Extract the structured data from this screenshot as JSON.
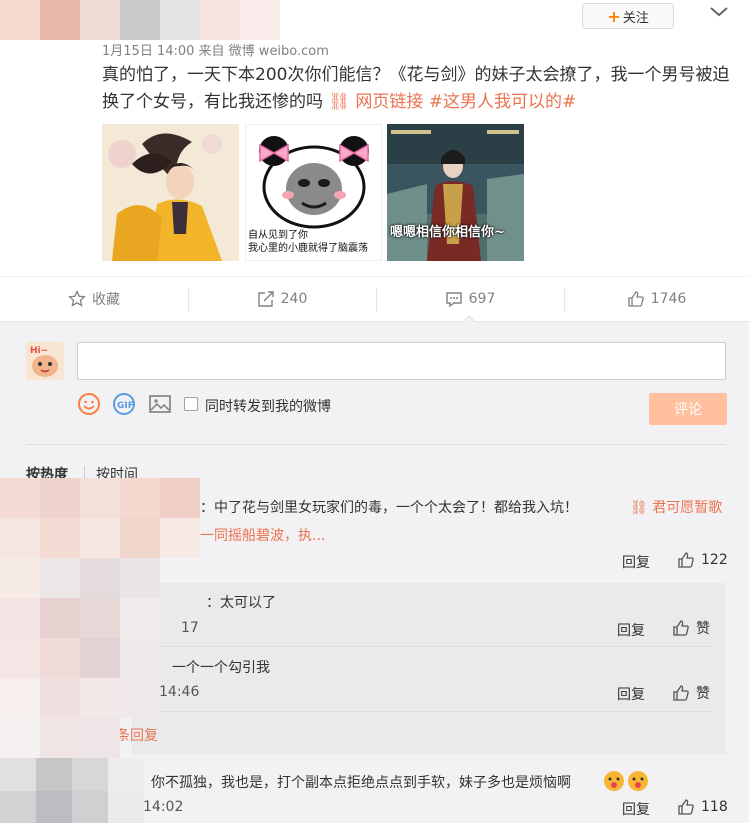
{
  "post": {
    "follow_label": "关注",
    "meta_text": "1月15日 14:00 来自 微博 weibo.com",
    "body_text": "真的怕了，一天下本200次你们能信？《花与剑》的妹子太会撩了，我一个男号被迫换了个女号，有比我还惨的吗",
    "link_label": "网页链接",
    "hashtag": "#这男人我可以的#",
    "images": [
      {
        "caption": ""
      },
      {
        "caption_line1": "自从见到了你",
        "caption_line2": "我心里的小鹿就得了脑震荡"
      },
      {
        "caption": "嗯嗯相信你相信你~"
      }
    ]
  },
  "actions": {
    "favorite": "收藏",
    "repost_count": "240",
    "comment_count": "697",
    "like_count": "1746"
  },
  "composer": {
    "forward_label": "同时转发到我的微博",
    "submit_label": "评论"
  },
  "sort_tabs": {
    "hot": "按热度",
    "time": "按时间"
  },
  "comments": [
    {
      "text": "：中了花与剑里女玩家们的毒，一个个太会了！都给我入坑！",
      "tag": "君可愿暂歌",
      "subline": "一同摇船碧波，执...",
      "reply_label": "回复",
      "likes": "122",
      "replies": [
        {
          "text": "：太可以了",
          "time": "17",
          "reply_label": "回复",
          "like_label": "赞"
        },
        {
          "text": "一个一个勾引我",
          "time": "14:46",
          "reply_label": "回复",
          "like_label": "赞"
        }
      ],
      "more_replies": "条回复"
    },
    {
      "text": "你不孤独，我也是，打个副本点拒绝点点到手软，妹子多也是烦恼啊",
      "time": "14:02",
      "reply_label": "回复",
      "likes": "118"
    }
  ],
  "colors": {
    "accent": "#eb7350",
    "follow_plus": "#ff8200",
    "submit_bg": "#ffc09f",
    "comment_bg": "#f2f2f5",
    "icon_orange": "#fa7d3c",
    "icon_blue": "#5c9ae0"
  }
}
